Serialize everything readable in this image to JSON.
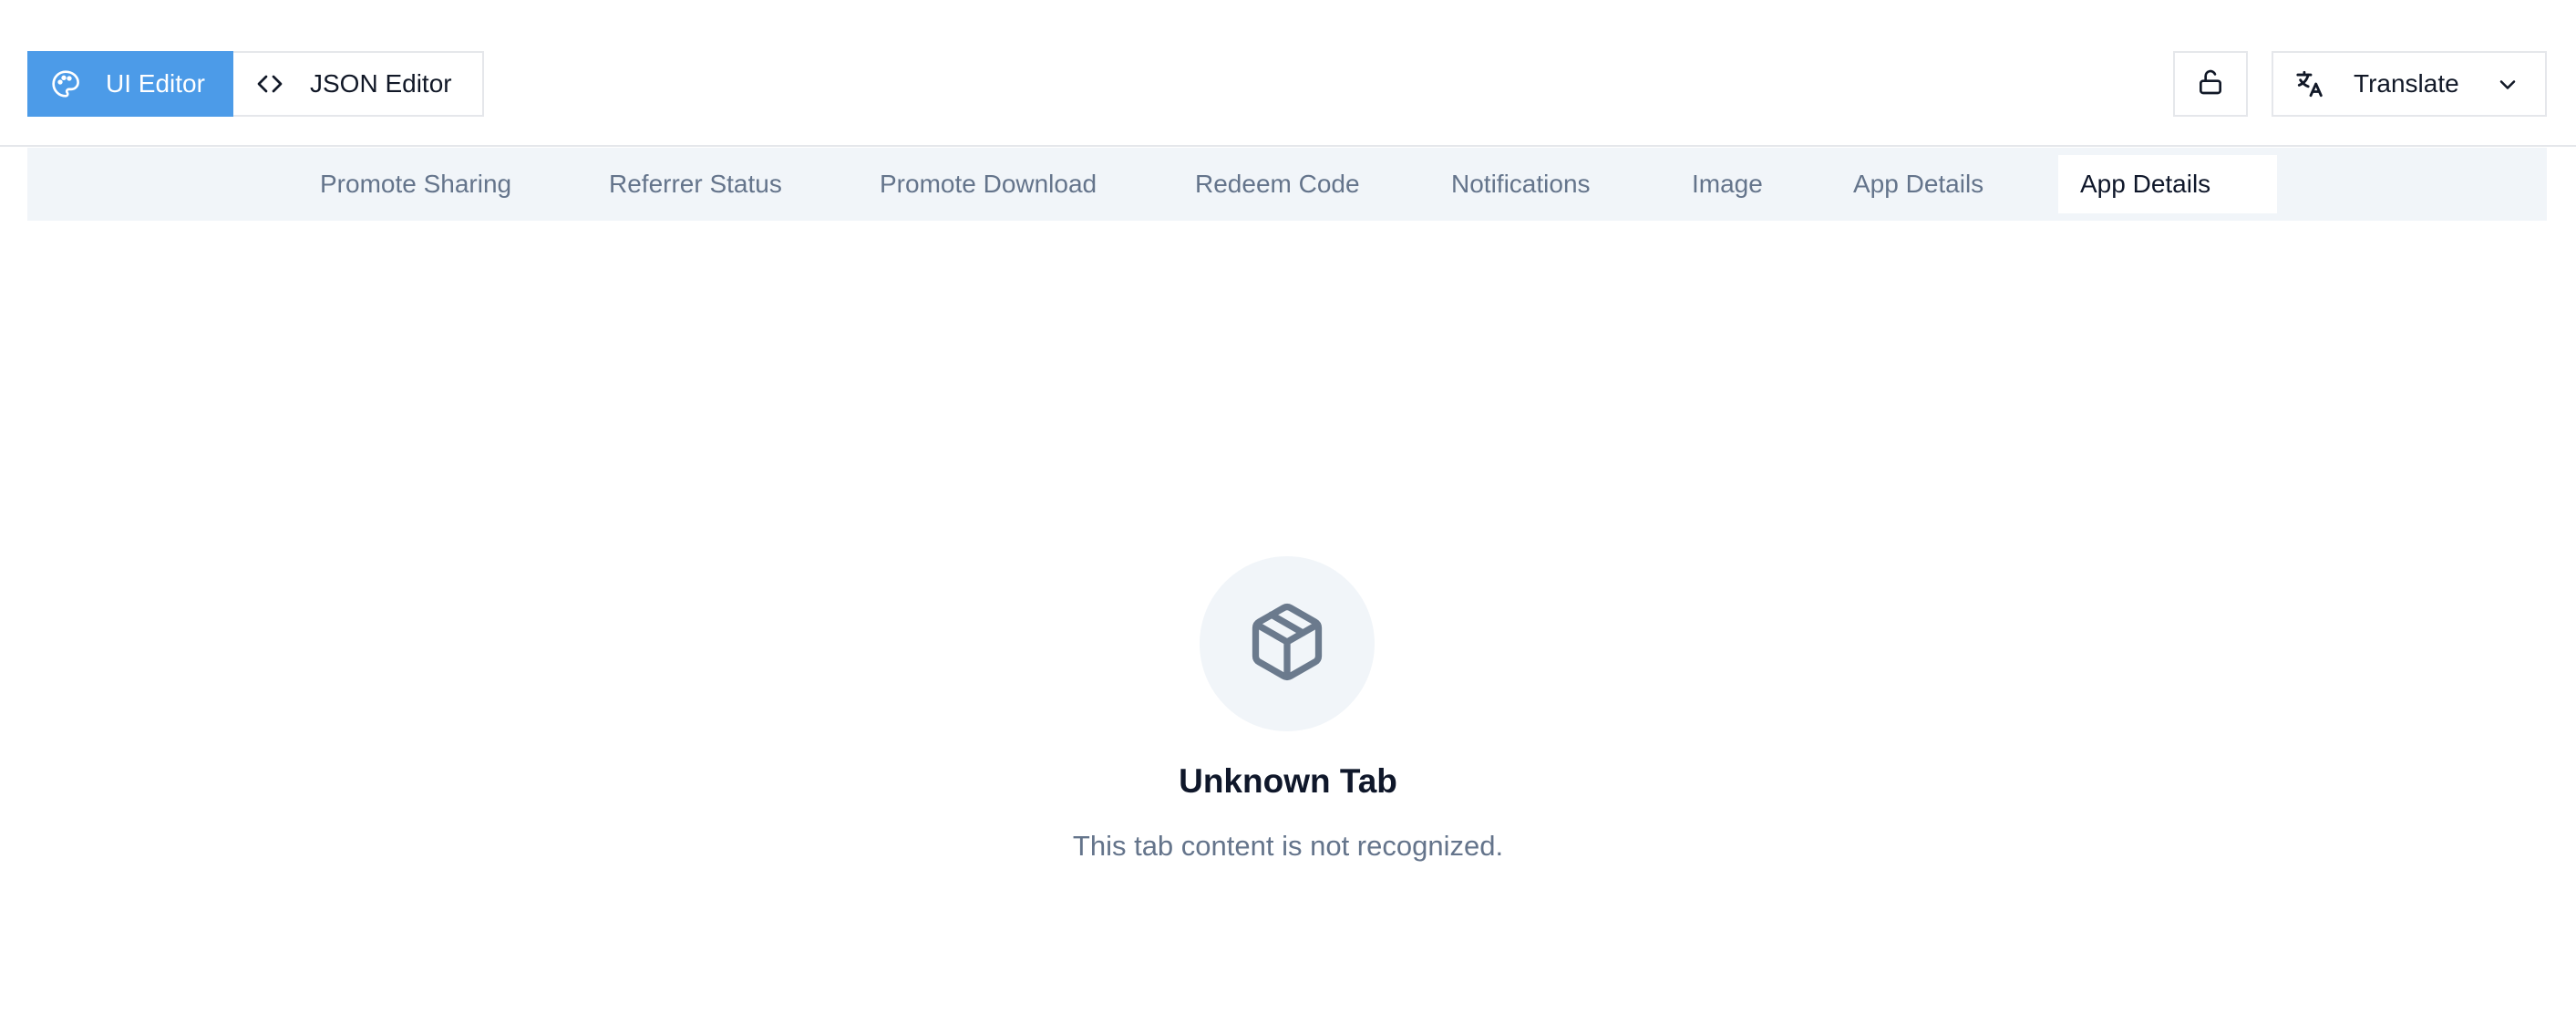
{
  "toolbar": {
    "ui_editor_label": "UI Editor",
    "json_editor_label": "JSON Editor",
    "translate_label": "Translate"
  },
  "tabs": [
    {
      "label": "Promote Sharing",
      "active": false
    },
    {
      "label": "Referrer Status",
      "active": false
    },
    {
      "label": "Promote Download",
      "active": false
    },
    {
      "label": "Redeem Code",
      "active": false
    },
    {
      "label": "Notifications",
      "active": false
    },
    {
      "label": "Image",
      "active": false
    },
    {
      "label": "App Details",
      "active": false
    },
    {
      "label": "App Details",
      "active": true
    }
  ],
  "empty_state": {
    "icon": "package-icon",
    "title": "Unknown Tab",
    "description": "This tab content is not recognized."
  },
  "colors": {
    "accent": "#4c9be8",
    "tabbar_bg": "#f1f5f9",
    "muted_text": "#64748b",
    "icon_gray": "#6b7a8d"
  }
}
